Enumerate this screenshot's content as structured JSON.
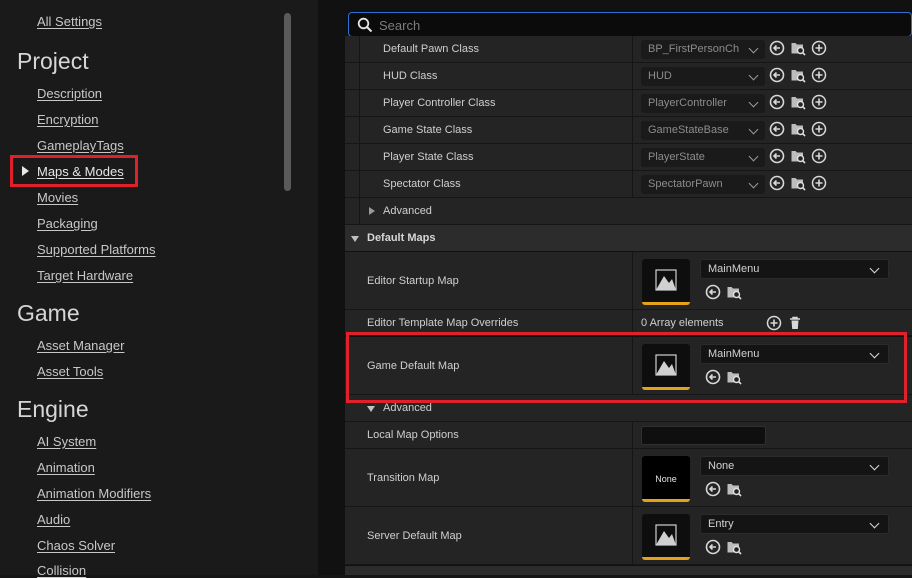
{
  "sidebar": {
    "all_settings": "All Settings",
    "sections": [
      {
        "title": "Project",
        "items": [
          "Description",
          "Encryption",
          "GameplayTags",
          "Maps & Modes",
          "Movies",
          "Packaging",
          "Supported Platforms",
          "Target Hardware"
        ]
      },
      {
        "title": "Game",
        "items": [
          "Asset Manager",
          "Asset Tools"
        ]
      },
      {
        "title": "Engine",
        "items": [
          "AI System",
          "Animation",
          "Animation Modifiers",
          "Audio",
          "Chaos Solver",
          "Collision"
        ]
      }
    ],
    "selected_item": "Maps & Modes"
  },
  "search": {
    "placeholder": "Search",
    "value": ""
  },
  "class_rows": [
    {
      "label": "Default Pawn Class",
      "value": "BP_FirstPersonCh"
    },
    {
      "label": "HUD Class",
      "value": "HUD"
    },
    {
      "label": "Player Controller Class",
      "value": "PlayerController"
    },
    {
      "label": "Game State Class",
      "value": "GameStateBase"
    },
    {
      "label": "Player State Class",
      "value": "PlayerState"
    },
    {
      "label": "Spectator Class",
      "value": "SpectatorPawn"
    }
  ],
  "advanced_label": "Advanced",
  "default_maps": {
    "title": "Default Maps",
    "editor_startup_map": {
      "label": "Editor Startup Map",
      "value": "MainMenu"
    },
    "editor_template_overrides": {
      "label": "Editor Template Map Overrides",
      "value": "0 Array elements"
    },
    "game_default_map": {
      "label": "Game Default Map",
      "value": "MainMenu"
    },
    "advanced_label": "Advanced",
    "local_map_options": {
      "label": "Local Map Options",
      "value": ""
    },
    "transition_map": {
      "label": "Transition Map",
      "value": "None",
      "thumb_text": "None"
    },
    "server_default_map": {
      "label": "Server Default Map",
      "value": "Entry"
    }
  },
  "colors": {
    "highlight": "#e0202a",
    "accent": "#2f6fd6",
    "asset_bar": "#e4a21a"
  }
}
